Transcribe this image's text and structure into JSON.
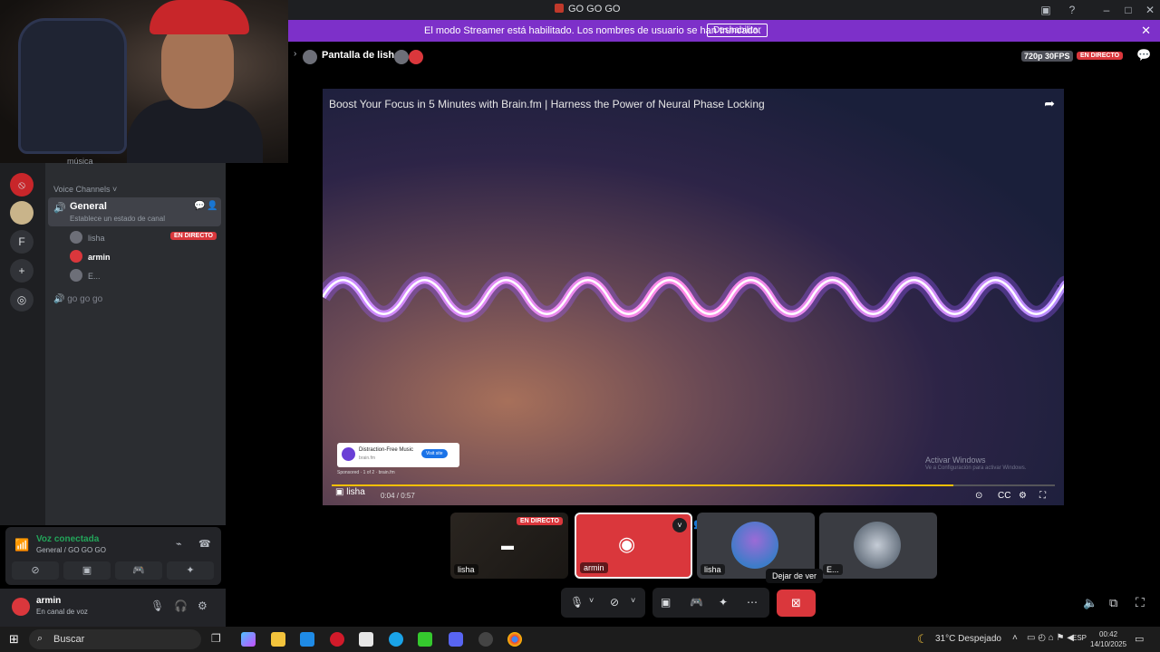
{
  "window": {
    "title": "GO GO GO"
  },
  "banner": {
    "message": "El modo Streamer está habilitado. Los nombres de usuario se han truncado.",
    "disable_label": "Deshabilitar"
  },
  "sidebar": {
    "server_letter": "F",
    "partial_channel": "música",
    "category": "Voice Channels",
    "voice_channel": {
      "name": "General",
      "status": "Establece un estado de canal",
      "users": [
        {
          "name": "lisha",
          "live": "EN DIRECTO"
        },
        {
          "name": "armin"
        },
        {
          "name": "E..."
        }
      ]
    },
    "other_channel": "go go go"
  },
  "voice_panel": {
    "status": "Voz conectada",
    "location": "General / GO GO GO"
  },
  "user_panel": {
    "username": "armin",
    "status": "En canal de voz"
  },
  "stream": {
    "title": "Pantalla de lisha",
    "quality": "720p 30FPS",
    "live": "EN DIRECTO",
    "video_title": "Boost Your Focus in 5 Minutes with Brain.fm | Harness the Power of Neural Phase Locking",
    "ad_title": "Distraction-Free Music",
    "ad_domain": "brain.fm",
    "ad_button": "Visit site",
    "sponsored": "Sponsored · 1 of 2 · brain.fm",
    "time": "0:04 / 0:57",
    "progress": 0.86,
    "streamer_label": "lisha",
    "watermark_title": "Activar Windows",
    "watermark_sub": "Ve a Configuración para activar Windows."
  },
  "tiles": [
    {
      "name": "lisha",
      "live": "EN DIRECTO"
    },
    {
      "name": "armin"
    },
    {
      "name": "lisha"
    },
    {
      "name": "E..."
    }
  ],
  "controls": {
    "tooltip": "Dejar de ver"
  },
  "taskbar": {
    "search": "Buscar",
    "temperature": "31°C",
    "weather": "Despejado",
    "language": "ESP",
    "time": "00:42",
    "date": "14/10/2025"
  },
  "colors": {
    "streamer_banner": "#7d30c9",
    "live_red": "#da373c",
    "voice_green": "#23a55a",
    "blurple": "#5865f2"
  }
}
